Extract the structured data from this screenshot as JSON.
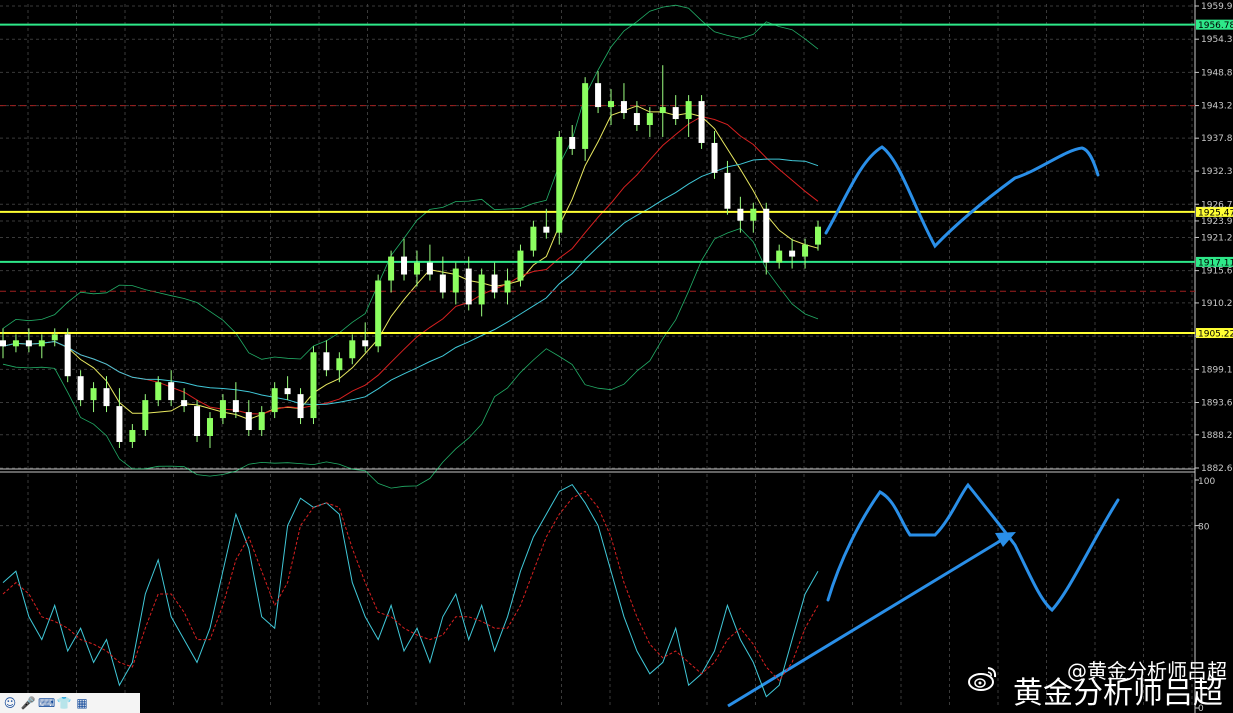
{
  "chart_data": [
    {
      "type": "candlestick",
      "title": "",
      "price_axis_ticks": [
        "1959.90",
        "1954.35",
        "1948.80",
        "1943.25",
        "1937.80",
        "1932.30",
        "1926.75",
        "1923.96",
        "1921.20",
        "1915.65",
        "1910.25",
        "1904.70",
        "1899.15",
        "1893.60",
        "1888.20",
        "1882.65"
      ],
      "ylim": [
        1882.65,
        1959.9
      ],
      "horizontal_levels": [
        {
          "value": "1956.78",
          "color": "#2ee889",
          "style": "solid"
        },
        {
          "value": "1925.47",
          "color": "#ffff33",
          "style": "solid"
        },
        {
          "value": "1917.11",
          "color": "#2ee889",
          "style": "solid"
        },
        {
          "value": "1905.22",
          "color": "#ffff33",
          "style": "solid"
        },
        {
          "value": "1943.25",
          "color": "#a02020",
          "style": "dashed"
        },
        {
          "value": "1912.20",
          "color": "#a02020",
          "style": "dashed"
        }
      ],
      "bar_colors": {
        "up": "#8cff60",
        "down": "#ffffff",
        "wick": "#9cff80"
      },
      "candles_ohlc": [
        [
          1904,
          1906,
          1901,
          1903
        ],
        [
          1903,
          1905,
          1902,
          1904
        ],
        [
          1904,
          1906,
          1902,
          1903
        ],
        [
          1903,
          1905,
          1901,
          1904
        ],
        [
          1904,
          1906,
          1903,
          1905
        ],
        [
          1905,
          1906,
          1897,
          1898
        ],
        [
          1898,
          1899,
          1893,
          1894
        ],
        [
          1894,
          1897,
          1892,
          1896
        ],
        [
          1896,
          1898,
          1892,
          1893
        ],
        [
          1893,
          1896,
          1886,
          1887
        ],
        [
          1887,
          1890,
          1886,
          1889
        ],
        [
          1889,
          1895,
          1888,
          1894
        ],
        [
          1894,
          1898,
          1893,
          1897
        ],
        [
          1897,
          1899,
          1893,
          1894
        ],
        [
          1894,
          1896,
          1892,
          1893
        ],
        [
          1893,
          1894,
          1887,
          1888
        ],
        [
          1888,
          1892,
          1886,
          1891
        ],
        [
          1891,
          1895,
          1890,
          1894
        ],
        [
          1894,
          1897,
          1891,
          1892
        ],
        [
          1892,
          1894,
          1888,
          1889
        ],
        [
          1889,
          1893,
          1888,
          1892
        ],
        [
          1892,
          1897,
          1891,
          1896
        ],
        [
          1896,
          1898,
          1894,
          1895
        ],
        [
          1895,
          1896,
          1890,
          1891
        ],
        [
          1891,
          1903,
          1890,
          1902
        ],
        [
          1902,
          1904,
          1898,
          1899
        ],
        [
          1899,
          1902,
          1897,
          1901
        ],
        [
          1901,
          1905,
          1900,
          1904
        ],
        [
          1904,
          1907,
          1902,
          1903
        ],
        [
          1903,
          1915,
          1902,
          1914
        ],
        [
          1914,
          1919,
          1912,
          1918
        ],
        [
          1918,
          1921,
          1914,
          1915
        ],
        [
          1915,
          1919,
          1913,
          1917
        ],
        [
          1917,
          1920,
          1914,
          1915
        ],
        [
          1915,
          1918,
          1911,
          1912
        ],
        [
          1912,
          1917,
          1910,
          1916
        ],
        [
          1916,
          1918,
          1909,
          1910
        ],
        [
          1910,
          1916,
          1908,
          1915
        ],
        [
          1915,
          1917,
          1911,
          1912
        ],
        [
          1912,
          1916,
          1910,
          1914
        ],
        [
          1914,
          1920,
          1913,
          1919
        ],
        [
          1919,
          1924,
          1918,
          1923
        ],
        [
          1923,
          1926,
          1921,
          1922
        ],
        [
          1922,
          1939,
          1920,
          1938
        ],
        [
          1938,
          1940,
          1935,
          1936
        ],
        [
          1936,
          1948,
          1934,
          1947
        ],
        [
          1947,
          1949,
          1942,
          1943
        ],
        [
          1943,
          1946,
          1940,
          1944
        ],
        [
          1944,
          1947,
          1941,
          1942
        ],
        [
          1942,
          1944,
          1939,
          1940
        ],
        [
          1940,
          1943,
          1938,
          1942
        ],
        [
          1942,
          1950,
          1938,
          1943
        ],
        [
          1943,
          1945,
          1940,
          1941
        ],
        [
          1941,
          1945,
          1938,
          1944
        ],
        [
          1944,
          1945,
          1936,
          1937
        ],
        [
          1937,
          1939,
          1931,
          1932
        ],
        [
          1932,
          1934,
          1925,
          1926
        ],
        [
          1926,
          1928,
          1922,
          1924
        ],
        [
          1924,
          1927,
          1922,
          1926
        ],
        [
          1926,
          1927,
          1915,
          1917
        ],
        [
          1917,
          1920,
          1916,
          1919
        ],
        [
          1919,
          1921,
          1916,
          1918
        ],
        [
          1918,
          1921,
          1916,
          1920
        ],
        [
          1920,
          1924,
          1919,
          1923
        ]
      ],
      "indicator_axis_ticks": [
        "100",
        "80",
        "0"
      ],
      "indicator_ylim": [
        0,
        100
      ],
      "stochastic_k": [
        55,
        60,
        40,
        30,
        45,
        25,
        35,
        20,
        30,
        10,
        20,
        50,
        65,
        40,
        30,
        20,
        35,
        60,
        85,
        70,
        40,
        35,
        80,
        92,
        88,
        90,
        85,
        55,
        40,
        30,
        45,
        25,
        35,
        20,
        40,
        50,
        30,
        45,
        25,
        40,
        60,
        75,
        85,
        95,
        98,
        90,
        80,
        60,
        40,
        25,
        15,
        20,
        35,
        10,
        15,
        25,
        45,
        30,
        20,
        5,
        10,
        30,
        50,
        60
      ],
      "stochastic_d": [
        50,
        55,
        50,
        40,
        38,
        35,
        30,
        28,
        25,
        20,
        18,
        35,
        50,
        50,
        42,
        30,
        30,
        45,
        65,
        75,
        60,
        45,
        55,
        80,
        88,
        90,
        88,
        70,
        55,
        42,
        40,
        35,
        32,
        30,
        32,
        40,
        40,
        38,
        35,
        35,
        45,
        60,
        75,
        85,
        92,
        95,
        88,
        75,
        55,
        40,
        28,
        22,
        25,
        20,
        15,
        20,
        30,
        35,
        28,
        18,
        12,
        20,
        35,
        45
      ],
      "forecast_drawings": "projection"
    }
  ],
  "watermark": {
    "small": "@黄金分析师吕超",
    "big": "黄金分析师吕超"
  },
  "toolbar": {
    "icons": [
      {
        "name": "smile-icon",
        "glyph": "☺"
      },
      {
        "name": "mic-icon",
        "glyph": "🎤"
      },
      {
        "name": "keyboard-icon",
        "glyph": "⌨"
      },
      {
        "name": "shirt-icon",
        "glyph": "👕"
      },
      {
        "name": "grid-icon",
        "glyph": "▦"
      }
    ]
  },
  "colors": {
    "background": "#000000",
    "grid": "#3a3a3a",
    "ma_red": "#d82020",
    "ma_yellow": "#e8e860",
    "ma_cyan": "#40c8d8",
    "bollinger": "#80e8a0",
    "forecast_blue": "#2a8fe8",
    "stoch_k": "#40c8d8",
    "stoch_d": "#d82020"
  }
}
